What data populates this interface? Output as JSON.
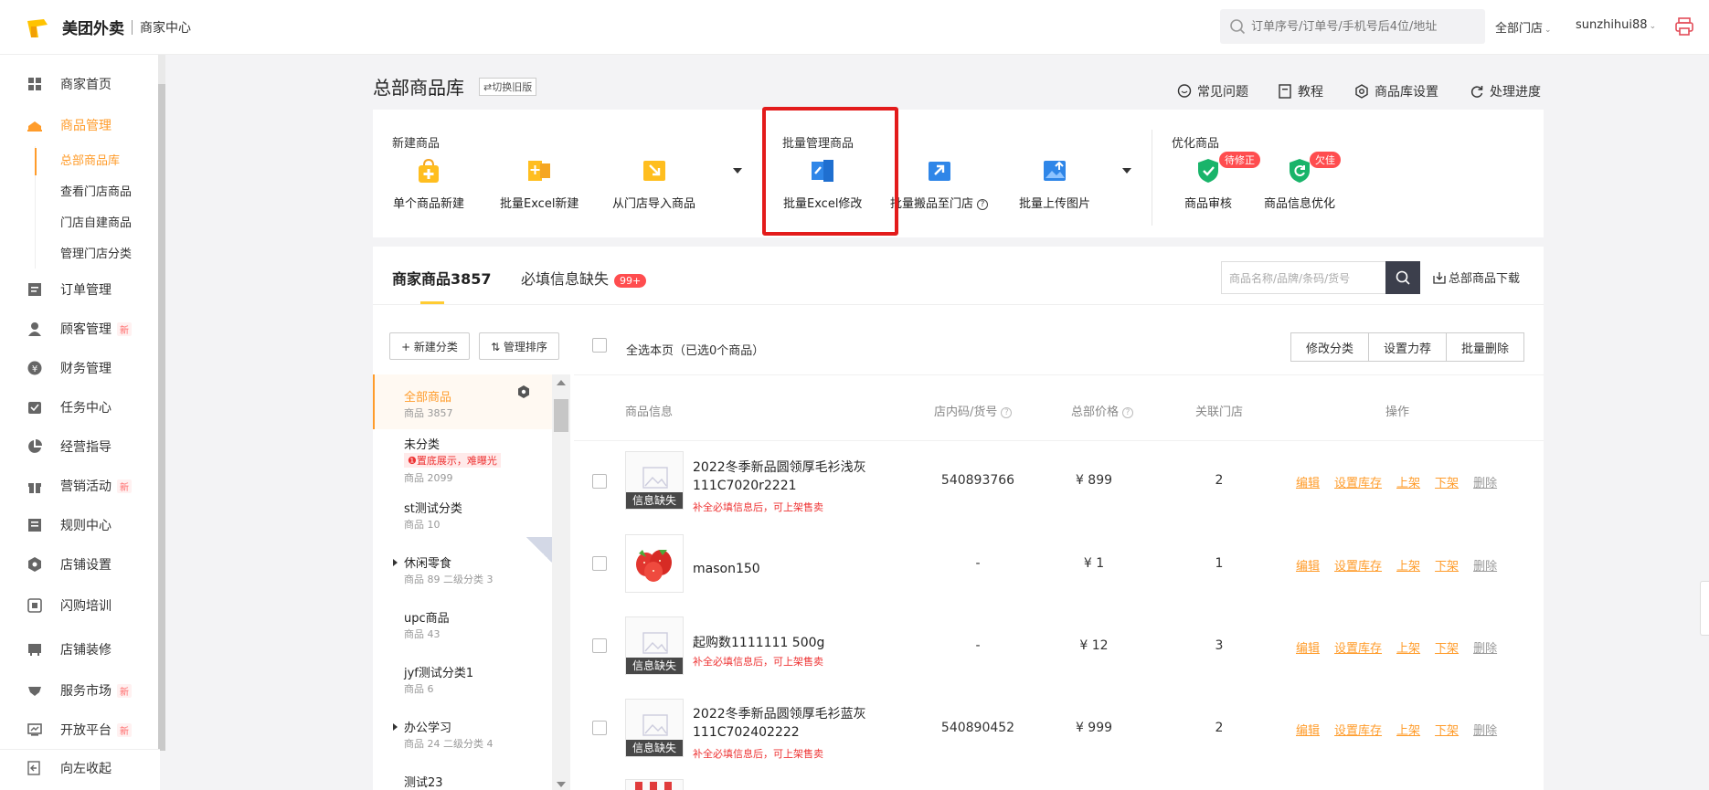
{
  "header": {
    "brand": "美团外卖",
    "brand_sub": "商家中心",
    "search_placeholder": "订单序号/订单号/手机号后4位/地址",
    "store_select": "全部门店",
    "username": "sunzhihui88",
    "logo_color": "#ffc300"
  },
  "sidebar": {
    "items": [
      {
        "label": "商家首页",
        "icon": "home-grid-icon"
      },
      {
        "label": "商品管理",
        "icon": "goods-icon",
        "active": true
      },
      {
        "label": "订单管理",
        "icon": "order-icon"
      },
      {
        "label": "顾客管理",
        "icon": "customer-icon",
        "tag": "新"
      },
      {
        "label": "财务管理",
        "icon": "finance-icon"
      },
      {
        "label": "任务中心",
        "icon": "task-icon"
      },
      {
        "label": "经营指导",
        "icon": "pie-icon"
      },
      {
        "label": "营销活动",
        "icon": "gift-icon",
        "tag": "新"
      },
      {
        "label": "规则中心",
        "icon": "rule-icon"
      },
      {
        "label": "店铺设置",
        "icon": "settings-icon"
      },
      {
        "label": "闪购培训",
        "icon": "training-icon"
      },
      {
        "label": "店铺装修",
        "icon": "decor-icon"
      },
      {
        "label": "服务市场",
        "icon": "market-icon",
        "tag": "新"
      },
      {
        "label": "开放平台",
        "icon": "open-platform-icon",
        "tag": "新"
      }
    ],
    "sub_items": [
      {
        "label": "总部商品库",
        "active": true
      },
      {
        "label": "查看门店商品"
      },
      {
        "label": "门店自建商品"
      },
      {
        "label": "管理门店分类"
      }
    ],
    "collapse_label": "向左收起",
    "accent": "#ff9c2b"
  },
  "page": {
    "title": "总部商品库",
    "switch_old": "⇄切换旧版",
    "links": [
      "常见问题",
      "教程",
      "商品库设置",
      "处理进度"
    ]
  },
  "toolbar": {
    "groups": [
      "新建商品",
      "批量管理商品",
      "优化商品"
    ],
    "tools": [
      {
        "label": "单个商品新建",
        "icon": "bag-plus-icon"
      },
      {
        "label": "批量Excel新建",
        "icon": "excel-new-icon"
      },
      {
        "label": "从门店导入商品",
        "icon": "import-store-icon"
      },
      {
        "label": "批量Excel修改",
        "icon": "excel-edit-icon"
      },
      {
        "label": "批量搬品至门店",
        "icon": "move-store-icon"
      },
      {
        "label": "批量上传图片",
        "icon": "upload-image-icon"
      },
      {
        "label": "商品审核",
        "icon": "shield-check-icon",
        "badge": "待修正"
      },
      {
        "label": "商品信息优化",
        "icon": "shield-refresh-icon",
        "badge": "欠佳"
      }
    ],
    "highlight_color": "#e31b1b"
  },
  "list": {
    "tabs": [
      {
        "label": "商家商品3857",
        "active": true
      },
      {
        "label": "必填信息缺失",
        "badge": "99+"
      }
    ],
    "search_placeholder": "商品名称/品牌/条码/货号",
    "download_label": "总部商品下载",
    "new_category": "+ 新建分类",
    "manage_sort": "⇅ 管理排序",
    "select_all": "全选本页（已选0个商品）",
    "bulk_actions": [
      "修改分类",
      "设置力荐",
      "批量删除"
    ],
    "columns": [
      "商品信息",
      "店内码/货号",
      "总部价格",
      "关联门店",
      "操作"
    ]
  },
  "categories": [
    {
      "name": "全部商品",
      "count": "商品 3857",
      "active": true
    },
    {
      "name": "未分类",
      "warn": "❶置底展示，难曝光",
      "count": "商品 2099"
    },
    {
      "name": "st测试分类",
      "count": "商品 10"
    },
    {
      "name": "休闲零食",
      "count": "商品 89 二级分类 3",
      "expandable": true
    },
    {
      "name": "upc商品",
      "count": "商品 43"
    },
    {
      "name": "jyf测试分类1",
      "count": "商品 6"
    },
    {
      "name": "办公学习",
      "count": "商品 24 二级分类 4",
      "expandable": true
    },
    {
      "name": "测试23",
      "count": ""
    }
  ],
  "products": [
    {
      "name_line1": "2022冬季新品圆领厚毛衫浅灰",
      "name_line2": "111C7020r2221",
      "warn": "补全必填信息后，可上架售卖",
      "thumb_tag": "信息缺失",
      "code": "540893766",
      "price": "¥ 899",
      "stores": "2"
    },
    {
      "name_line1": "mason150",
      "name_line2": "",
      "warn": "",
      "thumb_tag": "",
      "code": "-",
      "price": "¥ 1",
      "stores": "1"
    },
    {
      "name_line1": "起购数1111111 500g",
      "name_line2": "",
      "warn": "补全必填信息后，可上架售卖",
      "thumb_tag": "信息缺失",
      "code": "-",
      "price": "¥ 12",
      "stores": "3"
    },
    {
      "name_line1": "2022冬季新品圆领厚毛衫蓝灰",
      "name_line2": "111C702402222",
      "warn": "补全必填信息后，可上架售卖",
      "thumb_tag": "信息缺失",
      "code": "540890452",
      "price": "¥ 999",
      "stores": "2"
    }
  ],
  "row_ops": [
    "编辑",
    "设置库存",
    "上架",
    "下架",
    "删除"
  ]
}
